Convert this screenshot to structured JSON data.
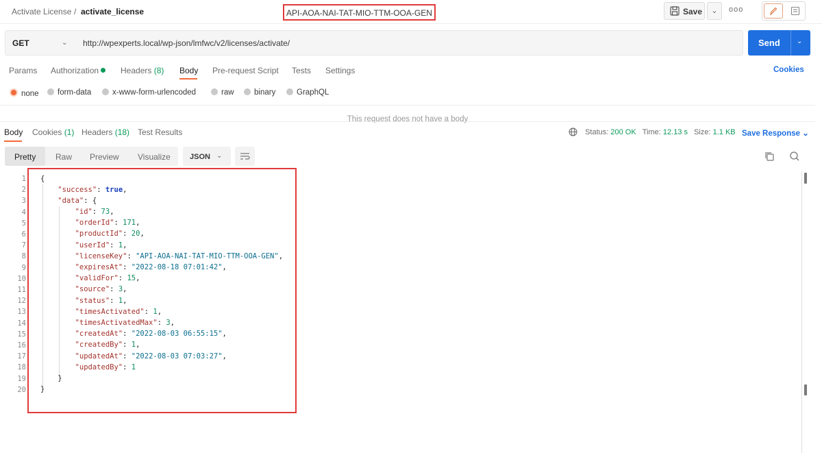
{
  "breadcrumb": {
    "parent": "Activate License",
    "separator": "/",
    "current": "activate_license"
  },
  "toolbar": {
    "save_label": "Save",
    "more_label": "ooo"
  },
  "request": {
    "method": "GET",
    "url_base": "http://wpexperts.local/wp-json/lmfwc/v2/licenses/activate/",
    "url_key": "API-AOA-NAI-TAT-MIO-TTM-OOA-GEN",
    "send_label": "Send"
  },
  "request_tabs": {
    "params": "Params",
    "authorization": "Authorization",
    "headers": "Headers",
    "headers_count": "(8)",
    "body": "Body",
    "prerequest": "Pre-request Script",
    "tests": "Tests",
    "settings": "Settings",
    "cookies": "Cookies"
  },
  "body_types": [
    "none",
    "form-data",
    "x-www-form-urlencoded",
    "raw",
    "binary",
    "GraphQL"
  ],
  "no_body_message": "This request does not have a body",
  "response_tabs": {
    "body": "Body",
    "cookies": "Cookies",
    "cookies_count": "(1)",
    "headers": "Headers",
    "headers_count": "(18)",
    "test_results": "Test Results"
  },
  "response_status": {
    "status_label": "Status:",
    "status_value": "200 OK",
    "time_label": "Time:",
    "time_value": "12.13 s",
    "size_label": "Size:",
    "size_value": "1.1 KB",
    "save_response": "Save Response"
  },
  "format_tabs": {
    "pretty": "Pretty",
    "raw": "Raw",
    "preview": "Preview",
    "visualize": "Visualize",
    "language": "JSON"
  },
  "code": {
    "line_numbers": [
      "1",
      "2",
      "3",
      "4",
      "5",
      "6",
      "7",
      "8",
      "9",
      "10",
      "11",
      "12",
      "13",
      "14",
      "15",
      "16",
      "17",
      "18",
      "19",
      "20"
    ],
    "success_key": "\"success\"",
    "success_value": "true",
    "data_key": "\"data\"",
    "fields": [
      {
        "key": "\"id\"",
        "value": "73",
        "type": "n"
      },
      {
        "key": "\"orderId\"",
        "value": "171",
        "type": "n"
      },
      {
        "key": "\"productId\"",
        "value": "20",
        "type": "n"
      },
      {
        "key": "\"userId\"",
        "value": "1",
        "type": "n"
      },
      {
        "key": "\"licenseKey\"",
        "value": "\"API-AOA-NAI-TAT-MIO-TTM-OOA-GEN\"",
        "type": "s"
      },
      {
        "key": "\"expiresAt\"",
        "value": "\"2022-08-18 07:01:42\"",
        "type": "s"
      },
      {
        "key": "\"validFor\"",
        "value": "15",
        "type": "n"
      },
      {
        "key": "\"source\"",
        "value": "3",
        "type": "n"
      },
      {
        "key": "\"status\"",
        "value": "1",
        "type": "n"
      },
      {
        "key": "\"timesActivated\"",
        "value": "1",
        "type": "n"
      },
      {
        "key": "\"timesActivatedMax\"",
        "value": "3",
        "type": "n"
      },
      {
        "key": "\"createdAt\"",
        "value": "\"2022-08-03 06:55:15\"",
        "type": "s"
      },
      {
        "key": "\"createdBy\"",
        "value": "1",
        "type": "n"
      },
      {
        "key": "\"updatedAt\"",
        "value": "\"2022-08-03 07:03:27\"",
        "type": "s"
      },
      {
        "key": "\"updatedBy\"",
        "value": "1",
        "type": "n"
      }
    ]
  },
  "colors": {
    "accent": "#f26b3a",
    "primary": "#1f6fe0",
    "success": "#0c9a5b",
    "highlight": "#e03a3a"
  }
}
